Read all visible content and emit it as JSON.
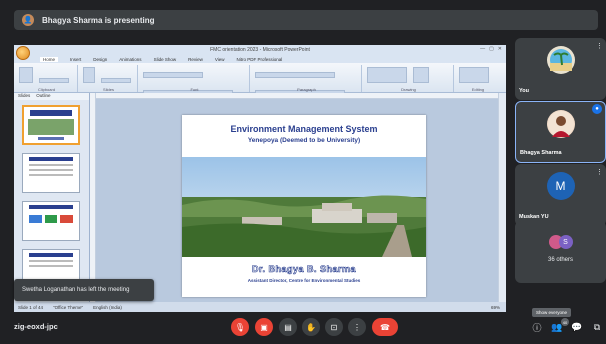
{
  "banner": {
    "text": "Bhagya Sharma is presenting"
  },
  "powerpoint": {
    "window_title": "FMC orientation 2023 - Microsoft PowerPoint",
    "tabs": [
      "Home",
      "Insert",
      "Design",
      "Animations",
      "Slide Show",
      "Review",
      "View",
      "Nitro PDF Professional"
    ],
    "groups": [
      "Clipboard",
      "Slides",
      "Font",
      "Paragraph",
      "Drawing",
      "Editing"
    ],
    "pane_tabs": [
      "Slides",
      "Outline"
    ],
    "status": {
      "slide": "Slide 1 of 44",
      "theme": "\"Office Theme\"",
      "language": "English (India)",
      "zoom": "69%"
    },
    "slide": {
      "title": "Environment Management System",
      "subtitle": "Yenepoya (Deemed to be University)",
      "presenter": "Dr. Bhagya B. Sharma",
      "role": "Assistant Director, Centre for Environmental Studies"
    }
  },
  "toast": {
    "text": "Swetha Loganathan has left the meeting"
  },
  "participants": [
    {
      "name": "You",
      "initial": ""
    },
    {
      "name": "Bhagya Sharma",
      "initial": ""
    },
    {
      "name": "Muskan YU",
      "initial": "M"
    },
    {
      "name": "36 others",
      "initial": "S"
    }
  ],
  "bottom": {
    "meeting_code": "zig-eoxd-jpc",
    "tooltip": "Show everyone",
    "people_count": "40"
  },
  "colors": {
    "bg": "#202124",
    "tile": "#3c4043",
    "red": "#ea4335",
    "accent": "#1a73e8",
    "slide_title": "#2a3f8f"
  }
}
